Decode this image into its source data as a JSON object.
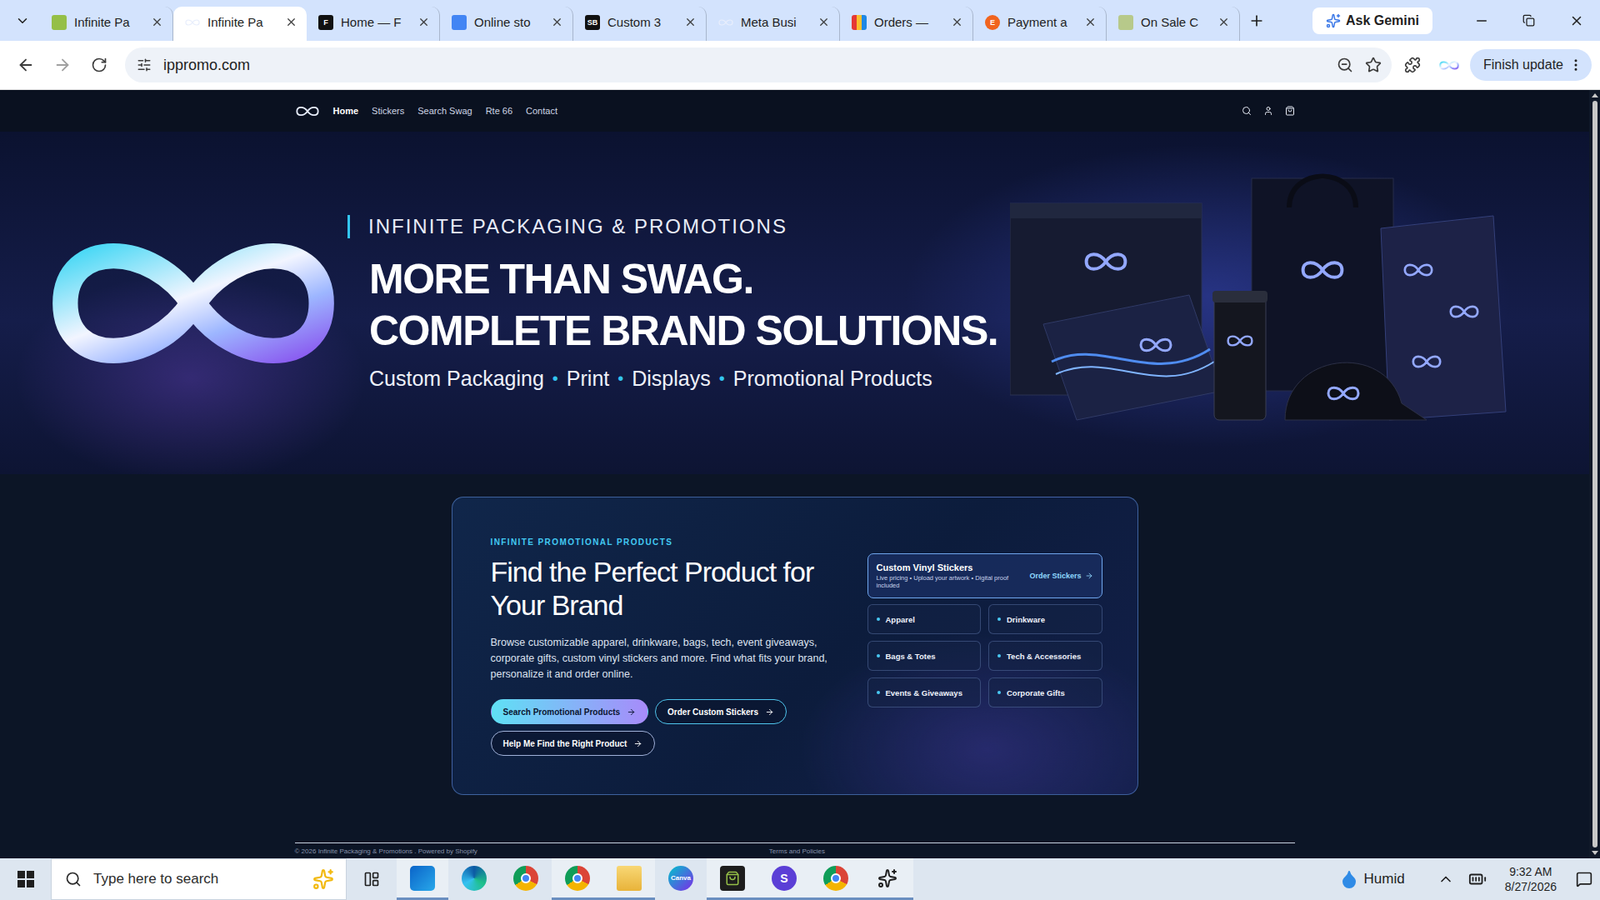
{
  "browser": {
    "tabs": [
      {
        "label": "Infinite Pa",
        "kind": "shopify",
        "selected": false
      },
      {
        "label": "Infinite Pa",
        "kind": "infinity",
        "selected": true
      },
      {
        "label": "Home — F",
        "kind": "square",
        "glyph": "F",
        "selected": false
      },
      {
        "label": "Online sto",
        "kind": "google",
        "selected": false
      },
      {
        "label": "Custom 3",
        "kind": "square",
        "glyph": "SB",
        "selected": false
      },
      {
        "label": "Meta Busi",
        "kind": "meta",
        "selected": false
      },
      {
        "label": "Orders —",
        "kind": "orders",
        "selected": false
      },
      {
        "label": "Payment a",
        "kind": "circle",
        "glyph": "E",
        "selected": false
      },
      {
        "label": "On Sale C",
        "kind": "stack",
        "selected": false
      }
    ],
    "gemini": "Ask Gemini",
    "address": "ippromo.com",
    "update": "Finish update"
  },
  "site": {
    "nav": [
      {
        "label": "Home",
        "selected": true
      },
      {
        "label": "Stickers",
        "selected": false
      },
      {
        "label": "Search Swag",
        "selected": false
      },
      {
        "label": "Rte 66",
        "selected": false
      },
      {
        "label": "Contact",
        "selected": false
      }
    ],
    "hero": {
      "eyebrow": "INFINITE PACKAGING & PROMOTIONS",
      "lines": [
        "MORE THAN SWAG.",
        "COMPLETE BRAND SOLUTIONS."
      ],
      "services": [
        "Custom Packaging",
        "Print",
        "Displays",
        "Promotional Products"
      ],
      "separator": "•"
    },
    "finder": {
      "eyebrow": "INFINITE PROMOTIONAL PRODUCTS",
      "title": "Find the Perfect Product for Your Brand",
      "text": "Browse customizable apparel, drinkware, bags, tech, event giveaways, corporate gifts, custom vinyl stickers and more. Find what fits your brand, personalize it and order online.",
      "buttons": [
        {
          "label": "Search Promotional Products",
          "kind": "primary"
        },
        {
          "label": "Order Custom Stickers",
          "kind": "outline"
        },
        {
          "label": "Help Me Find the Right Product",
          "kind": "ghost"
        }
      ],
      "featured": {
        "title": "Custom Vinyl Stickers",
        "text": "Live pricing • Upload your artwork • Digital proof included",
        "action": "Order Stickers"
      },
      "categories": [
        "Apparel",
        "Drinkware",
        "Bags & Totes",
        "Tech & Accessories",
        "Events & Giveaways",
        "Corporate Gifts"
      ]
    },
    "footer": {
      "copyright": "© 2026 Infinite Packaging & Promotions . Powered by Shopify",
      "links": "Terms and Policies"
    }
  },
  "taskbar": {
    "search": "Type here to search",
    "apps": [
      {
        "kind": "outlook",
        "open": true
      },
      {
        "kind": "edge",
        "open": false
      },
      {
        "kind": "chrome",
        "open": false
      },
      {
        "kind": "chrome-profile",
        "open": true
      },
      {
        "kind": "files",
        "open": true
      },
      {
        "kind": "canva",
        "label": "Canva",
        "open": false
      },
      {
        "kind": "shopify",
        "open": true
      },
      {
        "kind": "letter",
        "label": "S",
        "open": true
      },
      {
        "kind": "chrome",
        "open": true
      },
      {
        "kind": "chatgpt",
        "open": true
      }
    ],
    "weather": "Humid",
    "time": "9:32 AM",
    "date": "8/27/2026"
  }
}
